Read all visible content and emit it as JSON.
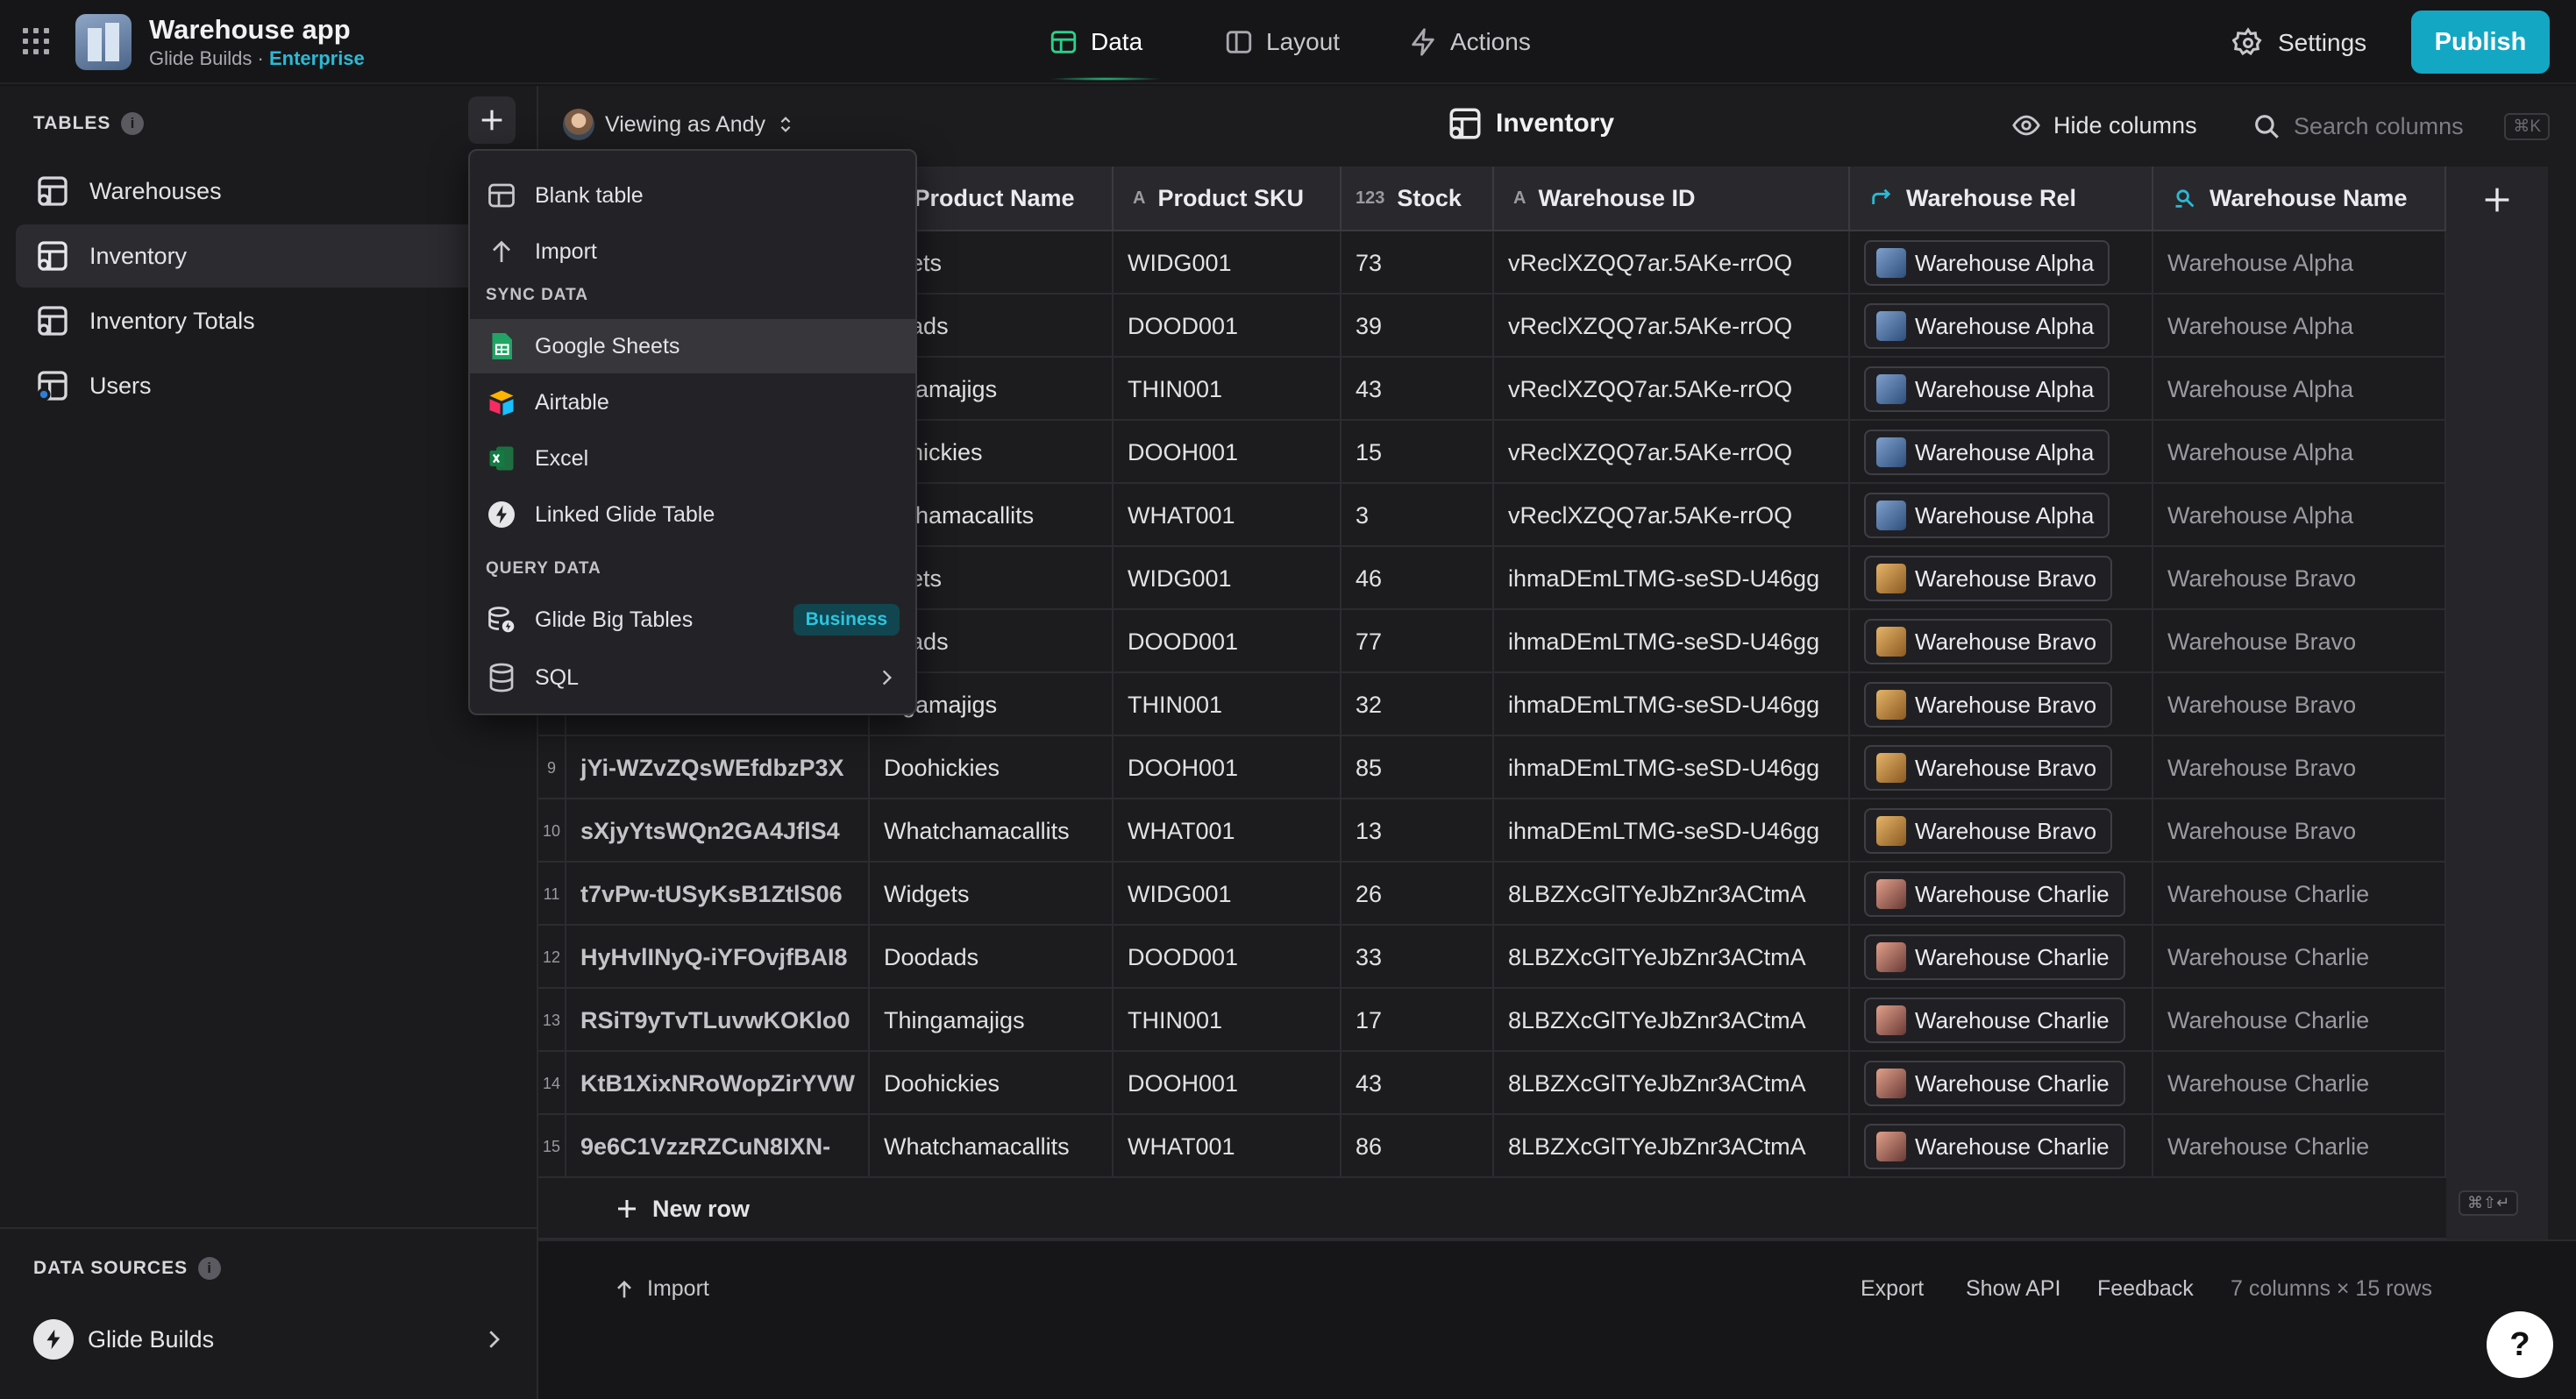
{
  "app": {
    "title": "Warehouse app",
    "subtitle_prefix": "Glide Builds · ",
    "plan": "Enterprise"
  },
  "nav": {
    "data": "Data",
    "layout": "Layout",
    "actions": "Actions",
    "settings": "Settings",
    "publish": "Publish"
  },
  "sidebar": {
    "tables_heading": "TABLES",
    "items": [
      {
        "label": "Warehouses"
      },
      {
        "label": "Inventory"
      },
      {
        "label": "Inventory Totals"
      },
      {
        "label": "Users"
      }
    ],
    "sources_heading": "DATA SOURCES",
    "source": "Glide Builds"
  },
  "toolbar": {
    "viewing_as": "Viewing as Andy",
    "table_title": "Inventory",
    "hide_columns": "Hide columns",
    "search_placeholder": "Search columns",
    "search_shortcut": "⌘K"
  },
  "columns": [
    {
      "name": "Product Name",
      "type_icon": "A"
    },
    {
      "name": "Product SKU",
      "type_icon": "A"
    },
    {
      "name": "Stock",
      "type_icon": "123"
    },
    {
      "name": "Warehouse ID",
      "type_icon": "A"
    },
    {
      "name": "Warehouse Rel",
      "type_icon": "relation-icon"
    },
    {
      "name": "Warehouse Name",
      "type_icon": "lookup-icon"
    }
  ],
  "rows": [
    {
      "n": "",
      "id": "",
      "name": "dgets",
      "sku": "WIDG001",
      "stock": "73",
      "wid": "vReclXZQQ7ar.5AKe-rrOQ",
      "rel": "Warehouse Alpha",
      "wname": "Warehouse Alpha",
      "thumb": "alpha"
    },
    {
      "n": "",
      "id": "",
      "name": "odads",
      "sku": "DOOD001",
      "stock": "39",
      "wid": "vReclXZQQ7ar.5AKe-rrOQ",
      "rel": "Warehouse Alpha",
      "wname": "Warehouse Alpha",
      "thumb": "alpha"
    },
    {
      "n": "",
      "id": "",
      "name": "ingamajigs",
      "sku": "THIN001",
      "stock": "43",
      "wid": "vReclXZQQ7ar.5AKe-rrOQ",
      "rel": "Warehouse Alpha",
      "wname": "Warehouse Alpha",
      "thumb": "alpha"
    },
    {
      "n": "",
      "id": "",
      "name": "oohickies",
      "sku": "DOOH001",
      "stock": "15",
      "wid": "vReclXZQQ7ar.5AKe-rrOQ",
      "rel": "Warehouse Alpha",
      "wname": "Warehouse Alpha",
      "thumb": "alpha"
    },
    {
      "n": "",
      "id": "",
      "name": "atchamacallits",
      "sku": "WHAT001",
      "stock": "3",
      "wid": "vReclXZQQ7ar.5AKe-rrOQ",
      "rel": "Warehouse Alpha",
      "wname": "Warehouse Alpha",
      "thumb": "alpha"
    },
    {
      "n": "",
      "id": "",
      "name": "dgets",
      "sku": "WIDG001",
      "stock": "46",
      "wid": "ihmaDEmLTMG-seSD-U46gg",
      "rel": "Warehouse Bravo",
      "wname": "Warehouse Bravo",
      "thumb": "bravo"
    },
    {
      "n": "",
      "id": "",
      "name": "odads",
      "sku": "DOOD001",
      "stock": "77",
      "wid": "ihmaDEmLTMG-seSD-U46gg",
      "rel": "Warehouse Bravo",
      "wname": "Warehouse Bravo",
      "thumb": "bravo"
    },
    {
      "n": "",
      "id": "",
      "name": "ingamajigs",
      "sku": "THIN001",
      "stock": "32",
      "wid": "ihmaDEmLTMG-seSD-U46gg",
      "rel": "Warehouse Bravo",
      "wname": "Warehouse Bravo",
      "thumb": "bravo"
    },
    {
      "n": "9",
      "id": "jYi-WZvZQsWEfdbzP3X",
      "name": "Doohickies",
      "sku": "DOOH001",
      "stock": "85",
      "wid": "ihmaDEmLTMG-seSD-U46gg",
      "rel": "Warehouse Bravo",
      "wname": "Warehouse Bravo",
      "thumb": "bravo"
    },
    {
      "n": "10",
      "id": "sXjyYtsWQn2GA4JflS4",
      "name": "Whatchamacallits",
      "sku": "WHAT001",
      "stock": "13",
      "wid": "ihmaDEmLTMG-seSD-U46gg",
      "rel": "Warehouse Bravo",
      "wname": "Warehouse Bravo",
      "thumb": "bravo"
    },
    {
      "n": "11",
      "id": "t7vPw-tUSyKsB1ZtlS06",
      "name": "Widgets",
      "sku": "WIDG001",
      "stock": "26",
      "wid": "8LBZXcGlTYeJbZnr3ACtmA",
      "rel": "Warehouse Charlie",
      "wname": "Warehouse Charlie",
      "thumb": "charlie"
    },
    {
      "n": "12",
      "id": "HyHvlINyQ-iYFOvjfBAI8",
      "name": "Doodads",
      "sku": "DOOD001",
      "stock": "33",
      "wid": "8LBZXcGlTYeJbZnr3ACtmA",
      "rel": "Warehouse Charlie",
      "wname": "Warehouse Charlie",
      "thumb": "charlie"
    },
    {
      "n": "13",
      "id": "RSiT9yTvTLuvwKOKlo0",
      "name": "Thingamajigs",
      "sku": "THIN001",
      "stock": "17",
      "wid": "8LBZXcGlTYeJbZnr3ACtmA",
      "rel": "Warehouse Charlie",
      "wname": "Warehouse Charlie",
      "thumb": "charlie"
    },
    {
      "n": "14",
      "id": "KtB1XixNRoWopZirYVW",
      "name": "Doohickies",
      "sku": "DOOH001",
      "stock": "43",
      "wid": "8LBZXcGlTYeJbZnr3ACtmA",
      "rel": "Warehouse Charlie",
      "wname": "Warehouse Charlie",
      "thumb": "charlie"
    },
    {
      "n": "15",
      "id": "9e6C1VzzRZCuN8IXN-",
      "name": "Whatchamacallits",
      "sku": "WHAT001",
      "stock": "86",
      "wid": "8LBZXcGlTYeJbZnr3ACtmA",
      "rel": "Warehouse Charlie",
      "wname": "Warehouse Charlie",
      "thumb": "charlie"
    }
  ],
  "new_row": "New row",
  "enter_shortcut": "⌘⇧↵",
  "footer": {
    "import": "Import",
    "export": "Export",
    "show_api": "Show API",
    "feedback": "Feedback",
    "count": "7 columns × 15 rows",
    "help": "?"
  },
  "menu": {
    "blank_table": "Blank table",
    "import": "Import",
    "sync_heading": "SYNC DATA",
    "google_sheets": "Google Sheets",
    "airtable": "Airtable",
    "excel": "Excel",
    "linked_glide_table": "Linked Glide Table",
    "query_heading": "QUERY DATA",
    "big_tables": "Glide Big Tables",
    "business_badge": "Business",
    "sql": "SQL"
  },
  "colors": {
    "accent": "#14a7c4",
    "data_tab": "#2bd18a",
    "enterprise": "#2bbad6"
  }
}
